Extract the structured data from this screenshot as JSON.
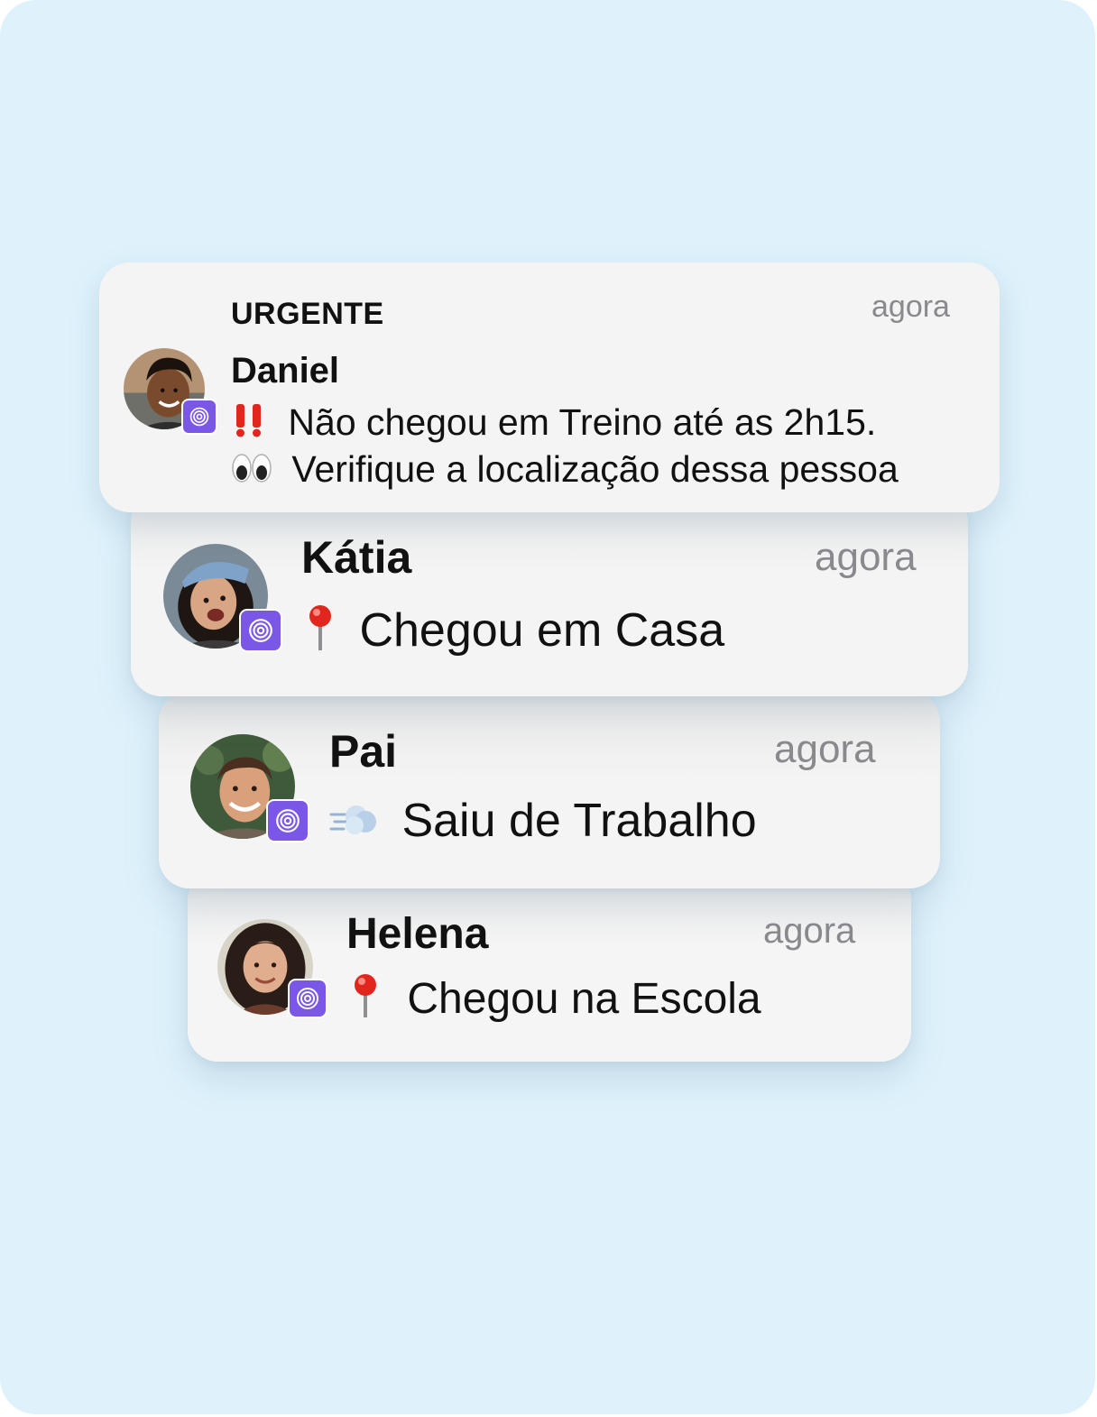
{
  "notifications": [
    {
      "header": "URGENTE",
      "name": "Daniel",
      "time": "agora",
      "line1_text": "Não chegou em Treino até as 2h15.",
      "line1_icon": "double-exclamation-icon",
      "line2_text": "Verifique a localização dessa pessoa",
      "line2_icon": "eyes-icon",
      "app_icon": "life360-icon"
    },
    {
      "name": "Kátia",
      "time": "agora",
      "text": "Chegou em Casa",
      "icon": "pin-icon",
      "app_icon": "life360-icon"
    },
    {
      "name": "Pai",
      "time": "agora",
      "text": "Saiu de Trabalho",
      "icon": "dash-cloud-icon",
      "app_icon": "life360-icon"
    },
    {
      "name": "Helena",
      "time": "agora",
      "text": "Chegou na Escola",
      "icon": "pin-icon",
      "app_icon": "life360-icon"
    }
  ],
  "colors": {
    "background": "#dff2fc",
    "card": "#f4f4f4",
    "badge": "#7b57e8",
    "time": "#8a8a8e",
    "alert": "#e0261d"
  }
}
